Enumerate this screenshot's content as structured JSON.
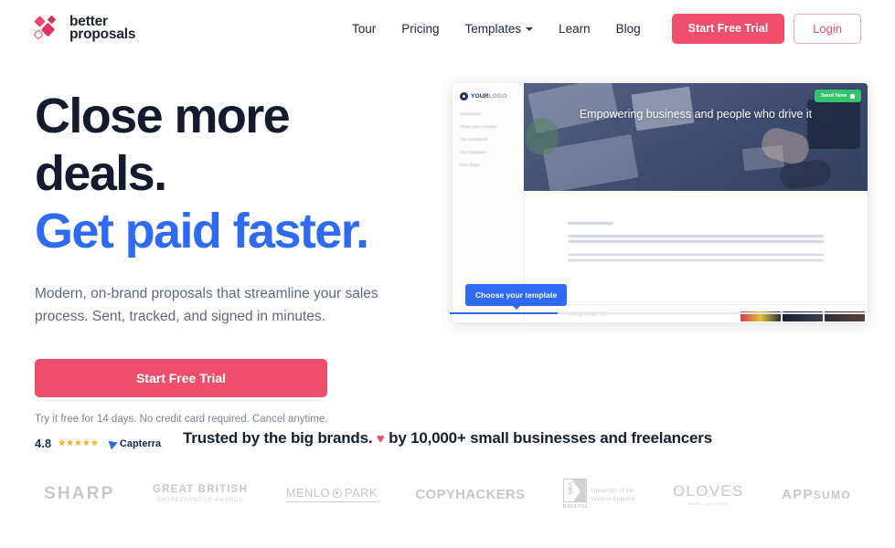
{
  "brand": {
    "logo_line1": "better",
    "logo_line2": "proposals",
    "accent_pink": "#ef4f6d",
    "accent_blue": "#2f6af3",
    "headline_navy": "#131c2e"
  },
  "nav": {
    "links": [
      {
        "label": "Tour",
        "has_chevron": false
      },
      {
        "label": "Pricing",
        "has_chevron": false
      },
      {
        "label": "Templates",
        "has_chevron": true
      },
      {
        "label": "Learn",
        "has_chevron": false
      },
      {
        "label": "Blog",
        "has_chevron": false
      }
    ],
    "trial_button": "Start Free Trial",
    "login_button": "Login"
  },
  "hero": {
    "headline_line1": "Close more deals.",
    "headline_line2": "Get paid faster.",
    "subcopy": "Modern, on-brand proposals that streamline your sales process. Sent, tracked, and signed in minutes.",
    "cta_label": "Start Free Trial",
    "fineprint": "Try it free for 14 days. No credit card required. Cancel anytime.",
    "rating": {
      "score": "4.8",
      "stars": "★★★★★",
      "source": "Capterra"
    }
  },
  "mockup": {
    "logo_text": "YOUR",
    "logo_text_light": "LOGO",
    "nav_items": [
      "Introduction",
      "About your company",
      "The Investment",
      "Our Guarantee",
      "Next Steps"
    ],
    "banner_title": "Empowering business and people who drive it",
    "send_button": "Send Now",
    "footer_text": "Doing things diff",
    "tooltip": "Choose your template"
  },
  "trusted": {
    "text_before": "Trusted by the big brands.",
    "heart": "♥",
    "text_after": "by 10,000+ small businesses and freelancers",
    "brands": [
      {
        "name": "SHARP"
      },
      {
        "name": "GREAT BRITISH",
        "sub": "ENTREPRENEUR AWARDS"
      },
      {
        "name": "MENLO",
        "name2": "PARK"
      },
      {
        "name": "COPYHACKERS"
      },
      {
        "name": "UWE",
        "sub": "BRISTOL",
        "full": "University of the",
        "full2": "West of England"
      },
      {
        "name": "OLOVES",
        "sub": "sweet. not sweet."
      },
      {
        "name": "APP",
        "name2": "SUMO"
      }
    ]
  }
}
